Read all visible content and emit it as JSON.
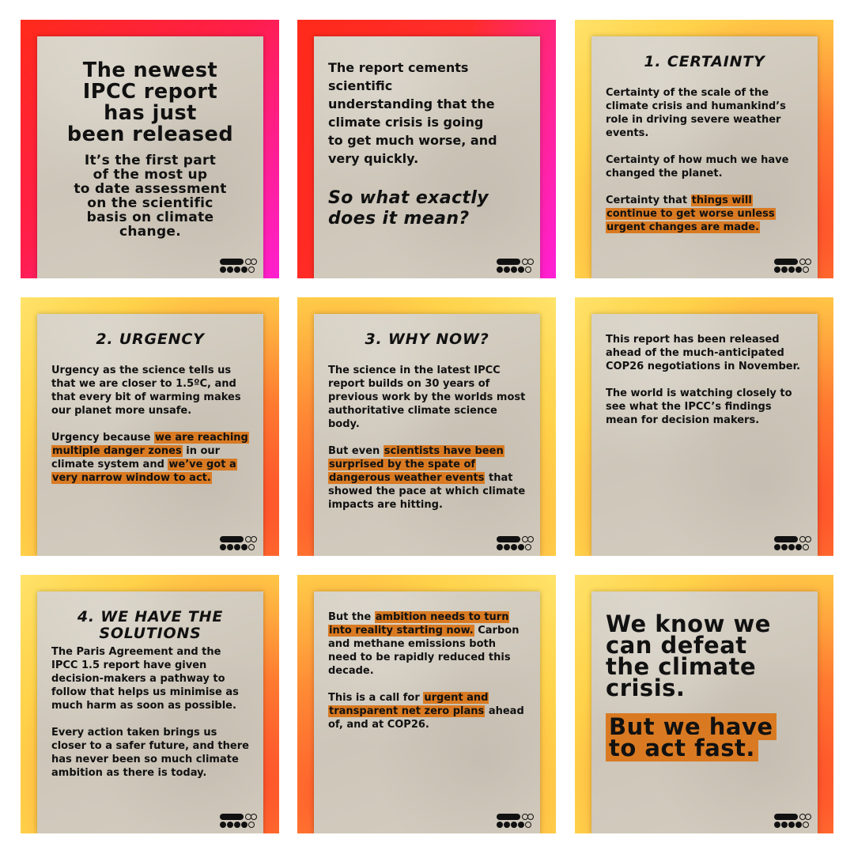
{
  "tiles": [
    {
      "title_lines": [
        "The newest",
        "IPCC report",
        "has just",
        "been released"
      ],
      "sub_lines": [
        "It’s the first part",
        "of the most up",
        "to date assessment",
        "on the scientific",
        "basis on climate",
        "change."
      ]
    },
    {
      "body_lines": [
        "The report cements",
        "scientific",
        "understanding that the",
        "climate crisis is going",
        "to get much worse, and",
        "very quickly."
      ],
      "question_lines": [
        "So what exactly",
        "does it mean?"
      ]
    },
    {
      "title": "1. CERTAINTY",
      "p1": "Certainty of the scale of the climate crisis and humankind’s role in driving severe weather events.",
      "p2": "Certainty of how much we have changed the planet.",
      "p3_pre": "Certainty that ",
      "p3_hl": "things will continue to get worse unless urgent changes are made."
    },
    {
      "title": "2. URGENCY",
      "p1": "Urgency as the science tells us that we are closer to 1.5ºC, and that every bit of warming makes our planet more unsafe.",
      "p2_pre": "Urgency because ",
      "p2_hl1": "we are reaching multiple danger zones",
      "p2_mid": " in our climate system and ",
      "p2_hl2": "we’ve got a very narrow window to act."
    },
    {
      "title": "3. WHY NOW?",
      "p1": "The science in the latest IPCC report builds on 30 years of previous work by the worlds most authoritative climate science body.",
      "p2_pre": "But even ",
      "p2_hl": "scientists have been surprised by the spate of dangerous weather events",
      "p2_post": " that showed the pace at which climate impacts are hitting."
    },
    {
      "p1": "This report has been released ahead of the much-anticipated COP26 negotiations in November.",
      "p2": "The world is watching closely to see what the IPCC’s findings mean for decision makers."
    },
    {
      "title_lines": [
        "4. WE HAVE THE",
        "SOLUTIONS"
      ],
      "p1": "The Paris Agreement and the IPCC 1.5 report have given decision-makers a pathway to follow that helps us minimise as much harm as soon as possible.",
      "p2": "Every action taken brings us closer to a safer future, and there has never been so much climate ambition as there is today."
    },
    {
      "p1_pre": "But the ",
      "p1_hl": "ambition needs to turn into reality starting now.",
      "p1_post": " Carbon and methane emissions both need to be rapidly reduced this decade.",
      "p2_pre": "This is a call for ",
      "p2_hl": "urgent and transparent net zero plans",
      "p2_post": " ahead of, and at COP26."
    },
    {
      "big_lines": [
        "We know we",
        "can defeat",
        "the climate",
        "crisis."
      ],
      "hl_lines": [
        "But we have",
        "to act fast."
      ]
    }
  ],
  "colors": {
    "highlight": "#d97a22",
    "paper": "#d3ccbf",
    "text": "#111111"
  },
  "icons": {
    "logo": "dot-grid-logo-icon"
  }
}
